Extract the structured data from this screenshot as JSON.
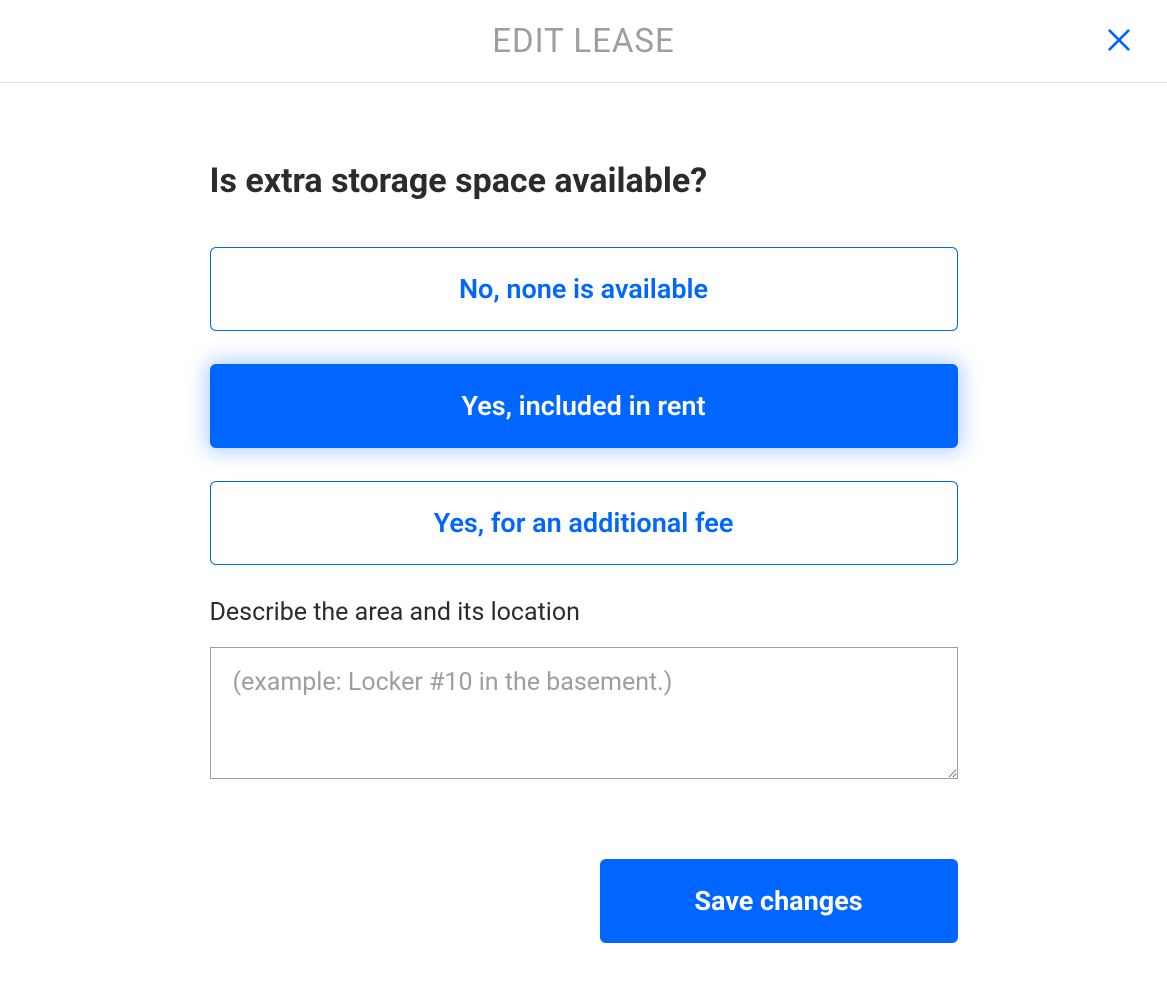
{
  "header": {
    "title": "EDIT LEASE"
  },
  "form": {
    "question": "Is extra storage space available?",
    "options": [
      {
        "label": "No, none is available",
        "selected": false
      },
      {
        "label": "Yes, included in rent",
        "selected": true
      },
      {
        "label": "Yes, for an additional fee",
        "selected": false
      }
    ],
    "describe": {
      "label": "Describe the area and its location",
      "placeholder": "(example: Locker #10 in the basement.)",
      "value": ""
    },
    "save_label": "Save changes"
  }
}
